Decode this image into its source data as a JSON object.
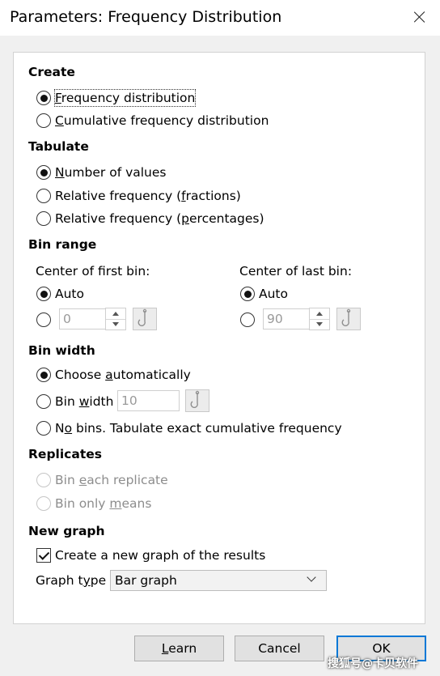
{
  "window": {
    "title": "Parameters: Frequency Distribution"
  },
  "create": {
    "header": "Create",
    "options": [
      {
        "pre": "",
        "mn": "F",
        "post": "requency distribution",
        "checked": true
      },
      {
        "pre": "",
        "mn": "C",
        "post": "umulative frequency distribution",
        "checked": false
      }
    ]
  },
  "tabulate": {
    "header": "Tabulate",
    "options": [
      {
        "pre": "",
        "mn": "N",
        "post": "umber of values",
        "checked": true
      },
      {
        "pre": "Relative frequency (",
        "mn": "f",
        "post": "ractions)",
        "checked": false
      },
      {
        "pre": "Relative frequency (",
        "mn": "p",
        "post": "ercentages)",
        "checked": false
      }
    ]
  },
  "bin_range": {
    "header": "Bin range",
    "first": {
      "label": "Center of first bin:",
      "auto": "Auto",
      "value": "0"
    },
    "last": {
      "label": "Center of last bin:",
      "auto": "Auto",
      "value": "90"
    }
  },
  "bin_width": {
    "header": "Bin width",
    "auto": {
      "pre": "Choose ",
      "mn": "a",
      "post": "utomatically"
    },
    "width": {
      "pre": "Bin ",
      "mn": "w",
      "post": "idth",
      "value": "10"
    },
    "nobins": {
      "pre": "N",
      "mn": "o",
      "post": " bins. Tabulate exact cumulative frequency"
    }
  },
  "replicates": {
    "header": "Replicates",
    "each": {
      "pre": "Bin ",
      "mn": "e",
      "post": "ach replicate"
    },
    "means": {
      "pre": "Bin only ",
      "mn": "m",
      "post": "eans"
    }
  },
  "new_graph": {
    "header": "New graph",
    "create": "Create a new graph of the results",
    "type_label": {
      "pre": "Graph t",
      "mn": "y",
      "post": "pe"
    },
    "type_value": "Bar graph"
  },
  "buttons": {
    "learn": {
      "pre": "",
      "mn": "L",
      "post": "earn"
    },
    "cancel": "Cancel",
    "ok": "OK"
  },
  "watermark": "搜狐号@卡贝软件"
}
